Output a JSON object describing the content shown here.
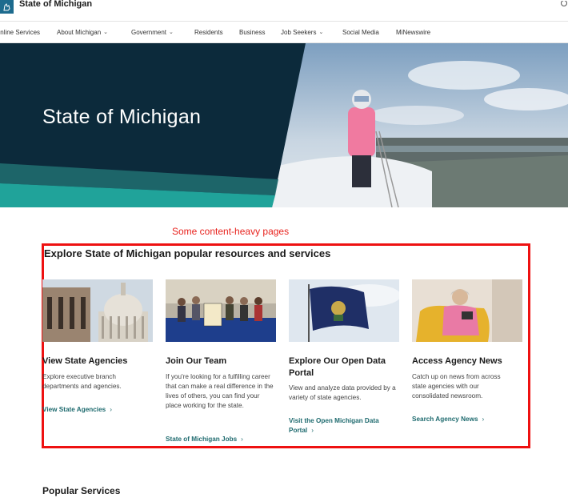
{
  "header": {
    "site_title": "State of Michigan"
  },
  "nav": {
    "items": [
      {
        "label": "Online Services",
        "dropdown": false
      },
      {
        "label": "About Michigan",
        "dropdown": true
      },
      {
        "label": "Government",
        "dropdown": true
      },
      {
        "label": "Residents",
        "dropdown": false
      },
      {
        "label": "Business",
        "dropdown": false
      },
      {
        "label": "Job Seekers",
        "dropdown": true
      },
      {
        "label": "Social Media",
        "dropdown": false
      },
      {
        "label": "MiNewswire",
        "dropdown": false
      }
    ]
  },
  "hero": {
    "title": "State of Michigan"
  },
  "annotation": {
    "label": "Some content-heavy pages",
    "color": "#e8231e"
  },
  "resources": {
    "title": "Explore State of Michigan popular resources and services",
    "cards": [
      {
        "title": "View State Agencies",
        "description": "Explore executive branch departments and agencies.",
        "link": "View State Agencies",
        "image_icon": "capitol-dome-image"
      },
      {
        "title": "Join Our Team",
        "description": "If you're looking for a fulfilling career that can make a real difference in the lives of others, you can find your place working for the state.",
        "link": "State of Michigan Jobs",
        "image_icon": "team-photo-image"
      },
      {
        "title": "Explore Our Open Data Portal",
        "description": "View and analyze data provided by a variety of state agencies.",
        "link": "Visit the Open Michigan Data Portal",
        "image_icon": "michigan-flag-image"
      },
      {
        "title": "Access Agency News",
        "description": "Catch up on news from across state agencies with our consolidated newsroom.",
        "link": "Search Agency News",
        "image_icon": "woman-reading-tablet-image"
      }
    ]
  },
  "popular": {
    "title": "Popular Services"
  },
  "colors": {
    "hero_dark": "#0c2a3b",
    "accent_teal": "#1f6b6f",
    "annotation_red": "#ee1111"
  }
}
